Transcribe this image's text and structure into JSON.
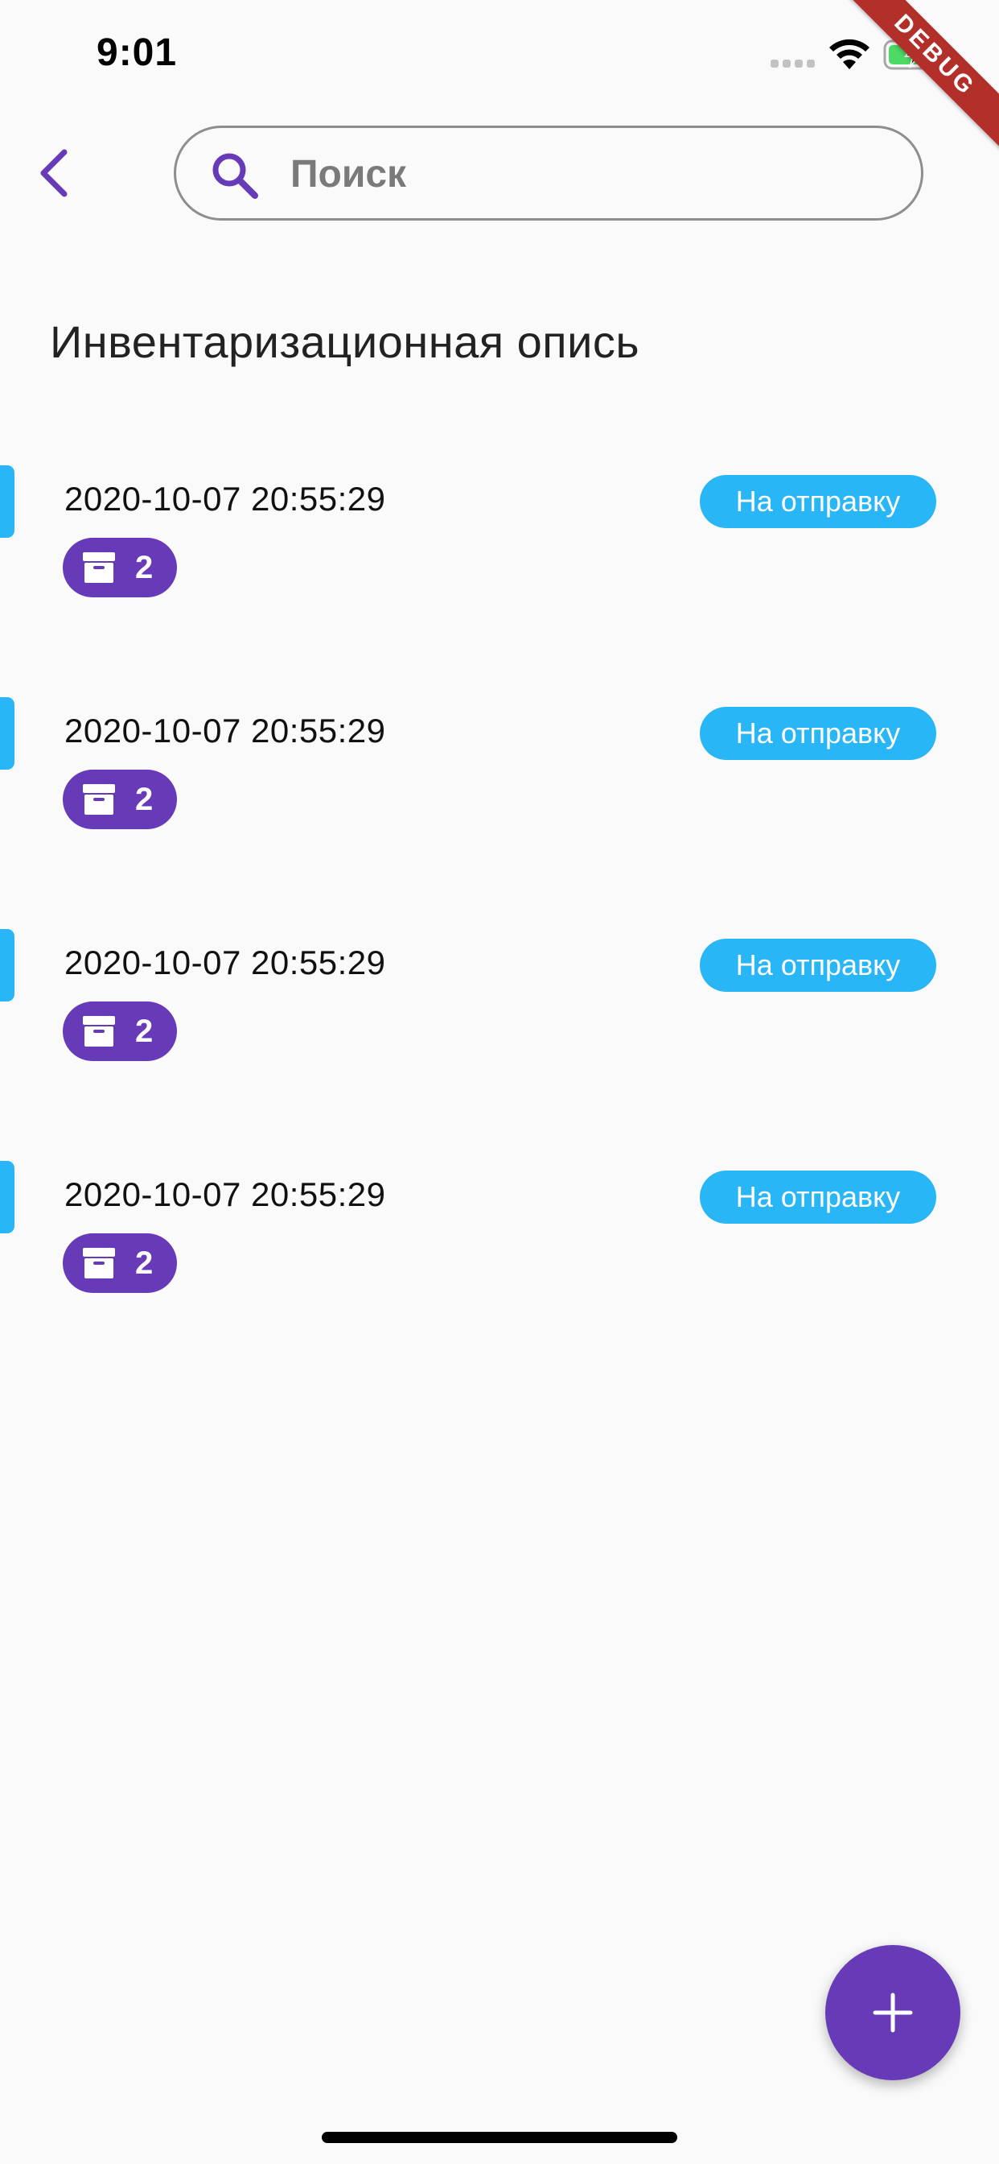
{
  "status_bar": {
    "time": "9:01",
    "icons": [
      "cellular-signal-icon",
      "wifi-icon",
      "battery-charging-icon"
    ]
  },
  "debug_banner": {
    "label": "DEBUG",
    "color": "#b3302a"
  },
  "header": {
    "back_icon": "chevron-left-icon",
    "search": {
      "icon": "search-icon",
      "placeholder": "Поиск",
      "value": ""
    }
  },
  "page": {
    "title": "Инвентаризационная опись"
  },
  "list": {
    "items": [
      {
        "date": "2020-10-07 20:55:29",
        "status": "На отправку",
        "count": "2",
        "icon": "package-box-icon"
      },
      {
        "date": "2020-10-07 20:55:29",
        "status": "На отправку",
        "count": "2",
        "icon": "package-box-icon"
      },
      {
        "date": "2020-10-07 20:55:29",
        "status": "На отправку",
        "count": "2",
        "icon": "package-box-icon"
      },
      {
        "date": "2020-10-07 20:55:29",
        "status": "На отправку",
        "count": "2",
        "icon": "package-box-icon"
      }
    ]
  },
  "fab": {
    "icon": "plus-icon"
  },
  "colors": {
    "primary": "#673ab7",
    "status_badge": "#29b6f6",
    "accent_bar": "#29b6f6",
    "background": "#fafafa",
    "search_border": "#8e8e8e",
    "debug": "#b3302a"
  }
}
